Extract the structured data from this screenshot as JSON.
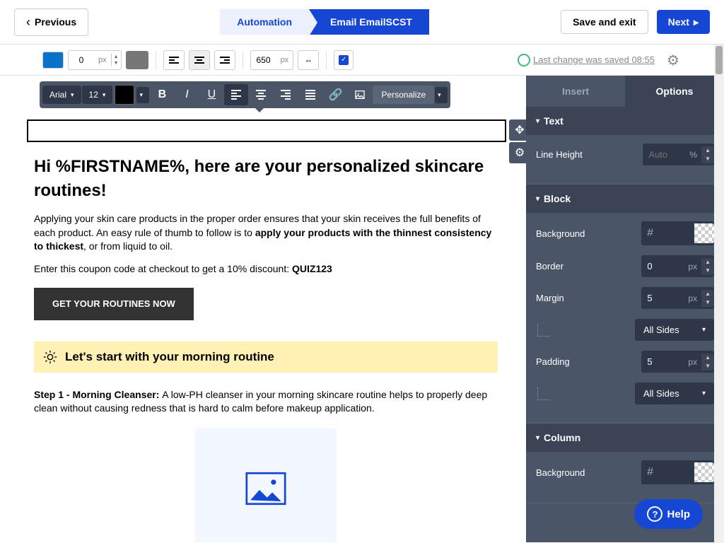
{
  "header": {
    "previous": "Previous",
    "automation": "Automation",
    "email": "Email EmailSCST",
    "save": "Save and exit",
    "next": "Next"
  },
  "toolbar1": {
    "padding": "0",
    "unit": "px",
    "width": "650",
    "wunit": "px",
    "saved": "Last change was saved 08:55"
  },
  "toolbar2": {
    "font": "Arial",
    "size": "12",
    "personalize": "Personalize"
  },
  "content": {
    "heading": "Hi %FIRSTNAME%, here are your personalized skincare routines!",
    "p1a": "Applying your skin care products in the proper order ensures that your skin receives the full benefits of each product. An easy rule of thumb to follow is to ",
    "p1b": "apply your products with the thinnest consistency to thickest",
    "p1c": ", or from liquid to oil.",
    "p2a": "Enter this coupon code at checkout to get a 10% discount: ",
    "p2b": "QUIZ123",
    "cta": "GET YOUR ROUTINES NOW",
    "callout": "Let's start with your morning routine",
    "step1a": "Step 1 - Morning Cleanser: ",
    "step1b": "A low-PH cleanser in your morning skincare routine helps to properly deep clean without causing redness that is hard to calm before makeup application."
  },
  "sidebar": {
    "insert": "Insert",
    "options": "Options",
    "text": {
      "title": "Text",
      "lineheight": "Line Height",
      "lh_val": "Auto",
      "lh_unit": "%"
    },
    "block": {
      "title": "Block",
      "bg": "Background",
      "border": "Border",
      "border_v": "0",
      "border_u": "px",
      "margin": "Margin",
      "margin_v": "5",
      "margin_u": "px",
      "margin_sel": "All Sides",
      "padding": "Padding",
      "padding_v": "5",
      "padding_u": "px",
      "padding_sel": "All Sides"
    },
    "column": {
      "title": "Column",
      "bg": "Background"
    }
  },
  "help": "Help"
}
